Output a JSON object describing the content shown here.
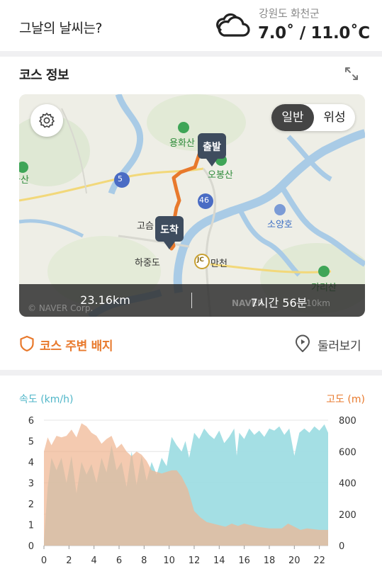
{
  "weather": {
    "question": "그날의 날씨는?",
    "location": "강원도 화천군",
    "temperature": "7.0˚ / 11.0˚C",
    "icon": "cloud-icon"
  },
  "course": {
    "title": "코스 정보",
    "map": {
      "mode_general": "일반",
      "mode_satellite": "위성",
      "start_label": "출발",
      "end_label": "도착",
      "places": {
        "yonghwasan": "용화산",
        "obongsan": "오봉산",
        "soyangho": "소양호",
        "manchon": "만천",
        "hajungdo": "하중도",
        "goseong": "고슴",
        "hwasan_left": "화산",
        "gaksan": "가리산"
      },
      "route_numbers": {
        "r5": "5",
        "r46": "46",
        "jc": "JC"
      },
      "watermark": "© NAVER Corp.",
      "watermark2": "NAVER",
      "scale": "10km",
      "distance": "23.16km",
      "duration": "7시간 56분"
    },
    "badge_link": "코스 주변 배지",
    "look_link": "둘러보기"
  },
  "chart_data": {
    "type": "area",
    "left_axis_label": "속도 (km/h)",
    "right_axis_label": "고도 (m)",
    "x_ticks": [
      "0",
      "2",
      "4",
      "6",
      "8",
      "10",
      "12",
      "14",
      "16",
      "18",
      "20",
      "22"
    ],
    "left_ticks": [
      "0",
      "1",
      "2",
      "3",
      "4",
      "5",
      "6"
    ],
    "right_ticks": [
      "0",
      "200",
      "400",
      "600",
      "800"
    ],
    "xlim": [
      0,
      22.7
    ],
    "ylim_left": [
      0,
      6
    ],
    "ylim_right": [
      0,
      800
    ],
    "series": [
      {
        "name": "속도 (km/h)",
        "color": "#9fdde3",
        "x": [
          0,
          0.3,
          0.6,
          1,
          1.4,
          1.8,
          2.2,
          2.6,
          3,
          3.4,
          3.8,
          4.2,
          4.6,
          5,
          5.4,
          5.8,
          6.2,
          6.6,
          7,
          7.4,
          7.8,
          8.2,
          8.6,
          9,
          9.4,
          9.8,
          10.2,
          10.6,
          11,
          11.3,
          11.6,
          12,
          12.4,
          12.8,
          13.2,
          13.6,
          14,
          14.4,
          14.8,
          15.2,
          15.4,
          15.6,
          16,
          16.4,
          16.8,
          17.2,
          17.6,
          18,
          18.4,
          18.8,
          19.2,
          19.6,
          20,
          20.4,
          20.8,
          21.2,
          21.6,
          22,
          22.4,
          22.7
        ],
        "y": [
          0.2,
          2.8,
          4.2,
          3.6,
          4.2,
          3.0,
          4.3,
          2.5,
          4.0,
          3.4,
          3.9,
          3.0,
          4.2,
          3.5,
          4.8,
          3.6,
          4.0,
          2.8,
          4.5,
          2.9,
          4.3,
          3.1,
          4.0,
          3.4,
          4.2,
          3.8,
          5.2,
          4.8,
          4.5,
          5.0,
          4.2,
          5.4,
          5.1,
          5.6,
          5.3,
          5.1,
          5.5,
          4.9,
          5.2,
          5.6,
          4.3,
          5.4,
          5.1,
          5.6,
          5.3,
          5.5,
          5.2,
          5.6,
          5.5,
          5.7,
          5.3,
          5.6,
          4.3,
          5.4,
          5.6,
          5.4,
          5.7,
          5.5,
          5.8,
          5.4
        ]
      },
      {
        "name": "고도 (m)",
        "color": "#f0b592",
        "x": [
          0,
          0.3,
          0.6,
          1,
          1.4,
          1.8,
          2.2,
          2.6,
          3,
          3.4,
          3.8,
          4.2,
          4.6,
          5,
          5.4,
          5.8,
          6.2,
          6.6,
          7,
          7.4,
          7.8,
          8.2,
          8.6,
          9,
          9.4,
          9.8,
          10.2,
          10.6,
          11,
          11.5,
          12,
          12.5,
          13,
          13.5,
          14,
          14.5,
          15,
          15.5,
          16,
          17,
          18,
          19,
          19.5,
          20,
          20.5,
          21,
          22,
          22.7
        ],
        "y": [
          600,
          690,
          640,
          700,
          690,
          700,
          740,
          690,
          780,
          760,
          720,
          700,
          650,
          680,
          700,
          620,
          650,
          600,
          570,
          600,
          580,
          540,
          480,
          470,
          460,
          470,
          480,
          480,
          440,
          360,
          220,
          180,
          150,
          140,
          130,
          120,
          140,
          125,
          140,
          120,
          110,
          110,
          140,
          120,
          100,
          110,
          100,
          100
        ]
      }
    ]
  }
}
